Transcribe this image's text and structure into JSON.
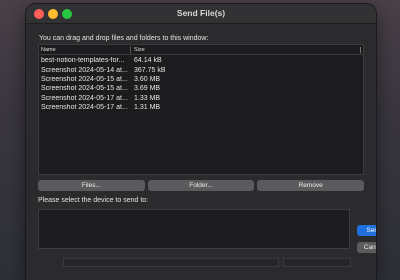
{
  "window": {
    "title": "Send File(s)"
  },
  "instructions": "You can drag and drop files and folders to this window:",
  "file_list": {
    "columns": {
      "name": "Name",
      "size": "Size"
    },
    "rows": [
      {
        "name": "best-notion-templates-for...",
        "size": "64.14 kB"
      },
      {
        "name": "Screenshot 2024-05-14 at...",
        "size": "367.75 kB"
      },
      {
        "name": "Screenshot 2024-05-15 at...",
        "size": "3.60 MB"
      },
      {
        "name": "Screenshot 2024-05-15 at...",
        "size": "3.69 MB"
      },
      {
        "name": "Screenshot 2024-05-17 at...",
        "size": "1.33 MB"
      },
      {
        "name": "Screenshot 2024-05-17 at...",
        "size": "1.31 MB"
      }
    ]
  },
  "buttons": {
    "files": "Files...",
    "folder": "Folder...",
    "remove": "Remove",
    "send": "Send",
    "cancel": "Cancel"
  },
  "device_label": "Please select the device to send to:",
  "colors": {
    "send_accent": "#1f6fdc",
    "close": "#ff5f57",
    "minimize": "#febc2e",
    "maximize": "#28c840"
  }
}
